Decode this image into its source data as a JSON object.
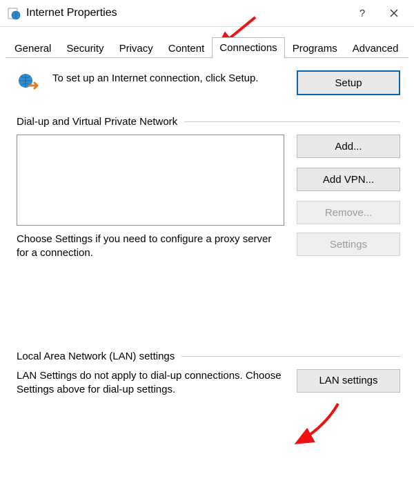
{
  "window": {
    "title": "Internet Properties"
  },
  "tabs": {
    "general": "General",
    "security": "Security",
    "privacy": "Privacy",
    "content": "Content",
    "connections": "Connections",
    "programs": "Programs",
    "advanced": "Advanced"
  },
  "setup": {
    "text": "To set up an Internet connection, click Setup.",
    "button": "Setup"
  },
  "dialup": {
    "group_label": "Dial-up and Virtual Private Network",
    "add": "Add...",
    "add_vpn": "Add VPN...",
    "remove": "Remove...",
    "proxy_text": "Choose Settings if you need to configure a proxy server for a connection.",
    "settings": "Settings"
  },
  "lan": {
    "group_label": "Local Area Network (LAN) settings",
    "text": "LAN Settings do not apply to dial-up connections. Choose Settings above for dial-up settings.",
    "button": "LAN settings"
  }
}
